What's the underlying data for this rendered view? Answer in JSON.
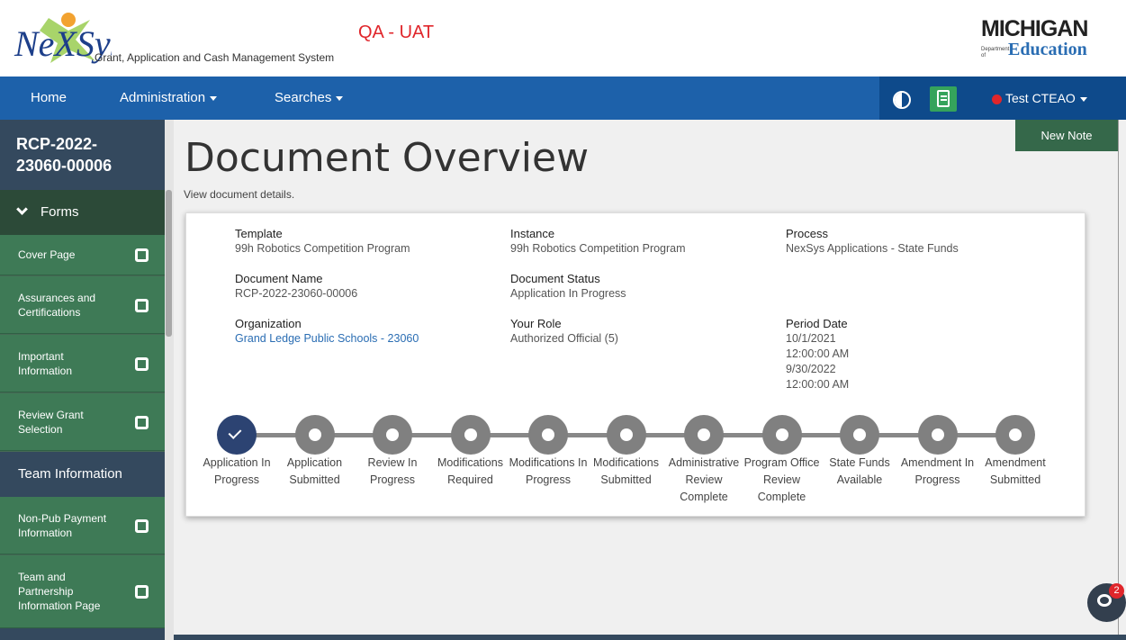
{
  "header": {
    "logo_text": "NeXSys",
    "subtitle": "Grant, Application and Cash Management System",
    "environment": "QA - UAT",
    "mde_top": "MICHIGAN",
    "mde_dept": "Department of",
    "mde_edu": "Education"
  },
  "nav": {
    "home": "Home",
    "administration": "Administration",
    "searches": "Searches",
    "user": "Test CTEAO"
  },
  "sidebar": {
    "doc_id": "RCP-2022-\n23060-00006",
    "forms_section": "Forms",
    "items": [
      {
        "label": "Cover Page"
      },
      {
        "label": "Assurances and Certifications"
      },
      {
        "label": "Important Information"
      },
      {
        "label": "Review Grant Selection"
      }
    ],
    "team_section": "Team Information",
    "team_items": [
      {
        "label": "Non-Pub Payment Information"
      },
      {
        "label": "Team and Partnership Information Page"
      }
    ]
  },
  "main": {
    "new_note": "New Note",
    "title": "Document Overview",
    "subtitle": "View document details."
  },
  "overview": {
    "template_label": "Template",
    "template_value": "99h Robotics Competition Program",
    "instance_label": "Instance",
    "instance_value": "99h Robotics Competition Program",
    "process_label": "Process",
    "process_value": "NexSys Applications - State Funds",
    "docname_label": "Document Name",
    "docname_value": "RCP-2022-23060-00006",
    "status_label": "Document Status",
    "status_value": "Application In Progress",
    "org_label": "Organization",
    "org_value": "Grand Ledge Public Schools - 23060",
    "role_label": "Your Role",
    "role_value": "Authorized Official (5)",
    "period_label": "Period Date",
    "period_start_date": "10/1/2021",
    "period_start_time": "12:00:00 AM",
    "period_end_date": "9/30/2022",
    "period_end_time": "12:00:00 AM"
  },
  "steps": [
    {
      "label": "Application In Progress",
      "done": true
    },
    {
      "label": "Application Submitted",
      "done": false
    },
    {
      "label": "Review In Progress",
      "done": false
    },
    {
      "label": "Modifications Required",
      "done": false
    },
    {
      "label": "Modifications In Progress",
      "done": false
    },
    {
      "label": "Modifications Submitted",
      "done": false
    },
    {
      "label": "Administrative Review Complete",
      "done": false
    },
    {
      "label": "Program Office Review Complete",
      "done": false
    },
    {
      "label": "State Funds Available",
      "done": false
    },
    {
      "label": "Amendment In Progress",
      "done": false
    },
    {
      "label": "Amendment Submitted",
      "done": false
    }
  ],
  "chat": {
    "badge": "2"
  },
  "colors": {
    "nav_blue": "#1d61aa",
    "sidebar_green": "#3e7a56",
    "sidebar_navy": "#34495e",
    "step_done": "#2c4372",
    "step_pending": "#808080",
    "env_red": "#e0262b"
  }
}
